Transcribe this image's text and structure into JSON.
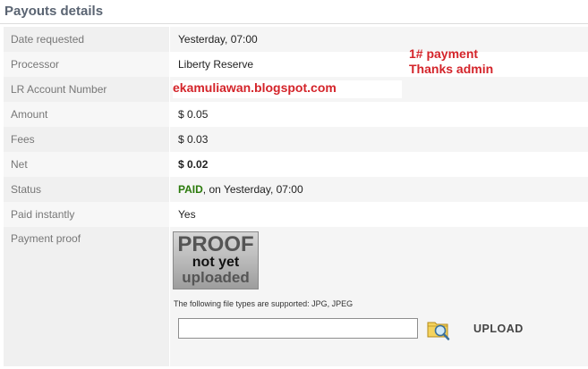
{
  "header": {
    "title": "Payouts details"
  },
  "rows": [
    {
      "label": "Date requested",
      "value": "Yesterday, 07:00"
    },
    {
      "label": "Processor",
      "value": "Liberty Reserve"
    },
    {
      "label": "LR Account Number",
      "value": "ekamuliawan.blogspot.com"
    },
    {
      "label": "Amount",
      "value": "$ 0.05"
    },
    {
      "label": "Fees",
      "value": "$ 0.03"
    },
    {
      "label": "Net",
      "value": "$ 0.02"
    },
    {
      "label": "Status",
      "value": "PAID",
      "suffix": ", on Yesterday, 07:00"
    },
    {
      "label": "Paid instantly",
      "value": "Yes"
    },
    {
      "label": "Payment proof"
    }
  ],
  "annotation": {
    "line1": "1# payment",
    "line2": "Thanks admin"
  },
  "proof_image": {
    "line1": "PROOF",
    "line2": "not yet",
    "line3": "uploaded"
  },
  "upload": {
    "note": "The following file types are supported: JPG, JPEG",
    "button_label": "UPLOAD",
    "icon": "folder-search-icon"
  },
  "colors": {
    "status_paid": "#2b7a0b",
    "annotation": "#d4242a"
  }
}
